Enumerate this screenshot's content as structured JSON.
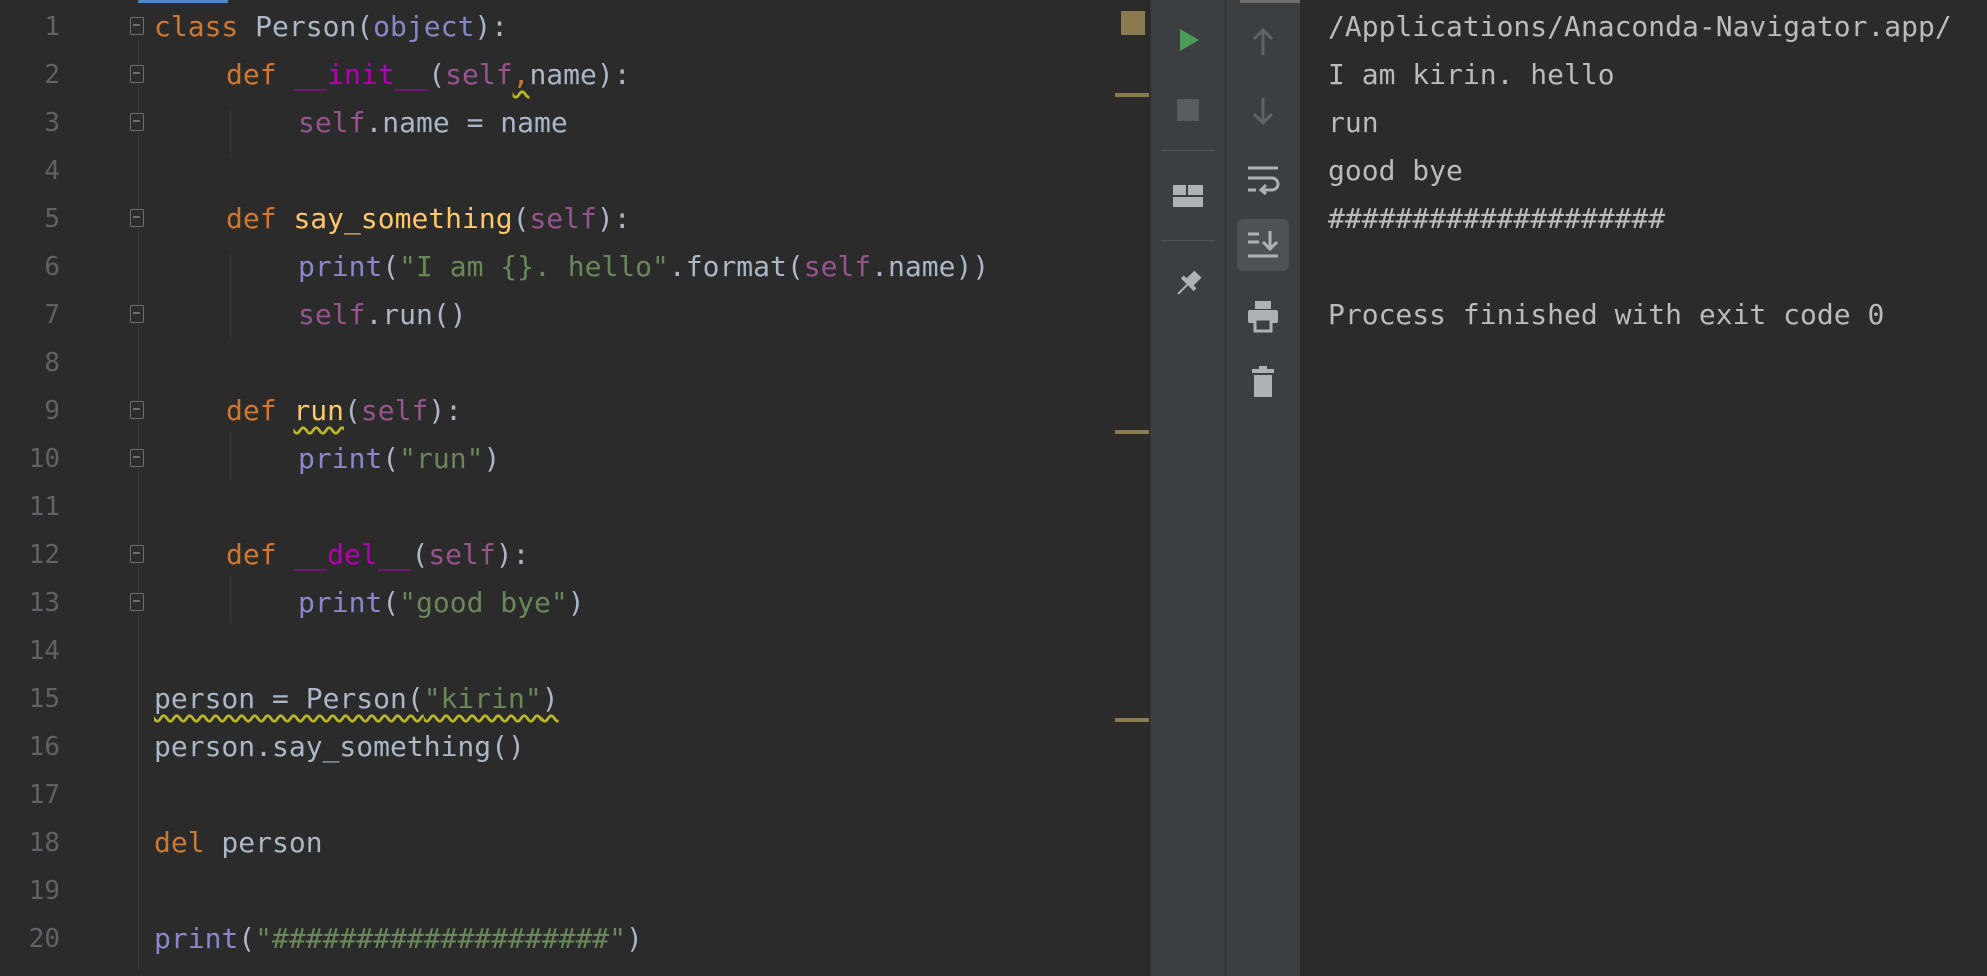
{
  "editor": {
    "lines": [
      {
        "n": "1"
      },
      {
        "n": "2"
      },
      {
        "n": "3"
      },
      {
        "n": "4"
      },
      {
        "n": "5"
      },
      {
        "n": "6"
      },
      {
        "n": "7"
      },
      {
        "n": "8"
      },
      {
        "n": "9"
      },
      {
        "n": "10"
      },
      {
        "n": "11"
      },
      {
        "n": "12"
      },
      {
        "n": "13"
      },
      {
        "n": "14"
      },
      {
        "n": "15"
      },
      {
        "n": "16"
      },
      {
        "n": "17"
      },
      {
        "n": "18"
      },
      {
        "n": "19"
      },
      {
        "n": "20"
      }
    ],
    "tokens": {
      "l1": [
        "class",
        " Person(",
        "object",
        "):"
      ],
      "l2": [
        "def",
        "__init__",
        "(",
        "self",
        ",",
        "name):"
      ],
      "l3": [
        "self",
        ".name = name"
      ],
      "l5": [
        "def",
        "say_something",
        "(",
        "self",
        "):"
      ],
      "l6": [
        "print",
        "(",
        "\"I am {}. hello\"",
        ".format(",
        "self",
        ".name))"
      ],
      "l7": [
        "self",
        ".run()"
      ],
      "l9": [
        "def",
        "run",
        "(",
        "self",
        "):"
      ],
      "l10": [
        "print",
        "(",
        "\"run\"",
        ")"
      ],
      "l12": [
        "def",
        "__del__",
        "(",
        "self",
        "):"
      ],
      "l13": [
        "print",
        "(",
        "\"good bye\"",
        ")"
      ],
      "l15": [
        "person = Person(",
        "\"kirin\"",
        ")"
      ],
      "l16": [
        "person.say_something()"
      ],
      "l18": [
        "del",
        " person"
      ],
      "l20": [
        "print",
        "(",
        "\"####################\"",
        ")"
      ]
    }
  },
  "console": {
    "lines": [
      "/Applications/Anaconda-Navigator.app/",
      "I am kirin. hello",
      "run",
      "good bye",
      "####################",
      "",
      "Process finished with exit code 0"
    ]
  },
  "colors": {
    "background": "#2b2b2b",
    "keyword": "#cc7832",
    "function": "#ffc66d",
    "string": "#6a8759",
    "self": "#94558d",
    "builtin": "#8888c6",
    "run_green": "#499c54"
  },
  "toolbar": {
    "left_icons": [
      "run-icon",
      "stop-icon",
      "layout-icon",
      "pin-icon"
    ],
    "right_icons": [
      "up-arrow-icon",
      "down-arrow-icon",
      "soft-wrap-icon",
      "scroll-to-end-icon",
      "print-icon",
      "trash-icon"
    ]
  }
}
